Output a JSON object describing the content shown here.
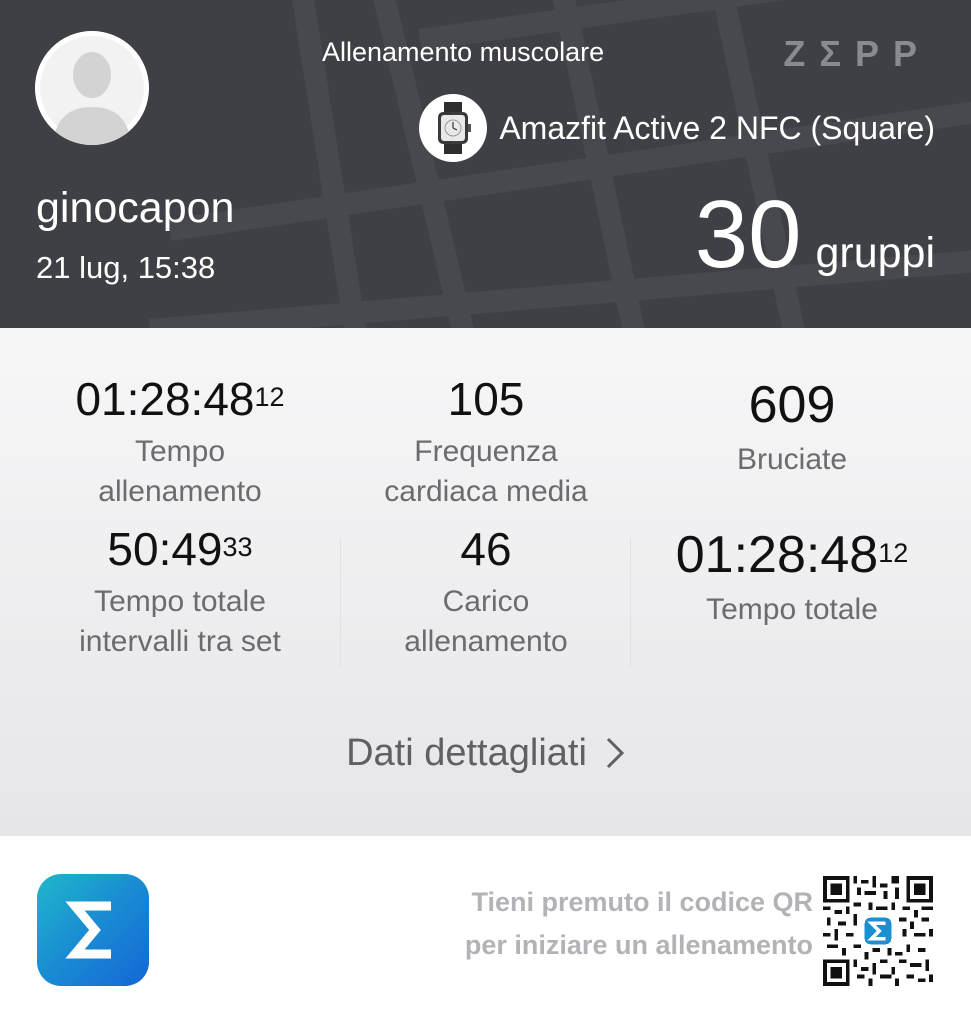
{
  "header": {
    "username": "ginocapon",
    "datetime": "21 lug, 15:38",
    "workout_type": "Allenamento muscolare",
    "brand": "ZΣPP",
    "device_name": "Amazfit Active 2 NFC (Square)",
    "sets_value": "30",
    "sets_unit": "gruppi",
    "icons": [
      "avatar-placeholder-icon",
      "watch-icon"
    ]
  },
  "stats": [
    {
      "value": "01:28:48",
      "sup": "12",
      "label_line1": "Tempo",
      "label_line2": "allenamento"
    },
    {
      "value": "105",
      "sup": "",
      "label_line1": "Frequenza",
      "label_line2": "cardiaca media"
    },
    {
      "value": "609",
      "sup": "",
      "label_line1": "Bruciate",
      "label_line2": ""
    },
    {
      "value": "50:49",
      "sup": "33",
      "label_line1": "Tempo totale",
      "label_line2": "intervalli tra set"
    },
    {
      "value": "46",
      "sup": "",
      "label_line1": "Carico",
      "label_line2": "allenamento"
    },
    {
      "value": "01:28:48",
      "sup": "12",
      "label_line1": "Tempo totale",
      "label_line2": ""
    }
  ],
  "details_link": "Dati dettagliati",
  "footer": {
    "qr_line1": "Tieni premuto il codice QR",
    "qr_line2": "per iniziare un allenamento",
    "app_icon": "zepp-sigma-icon",
    "qr_icon": "qr-code-icon"
  },
  "colors": {
    "header_bg": "#3f4045",
    "app_icon_gradient": [
      "#1fb8c9",
      "#1566d6"
    ],
    "label_gray": "#6b6b70"
  }
}
